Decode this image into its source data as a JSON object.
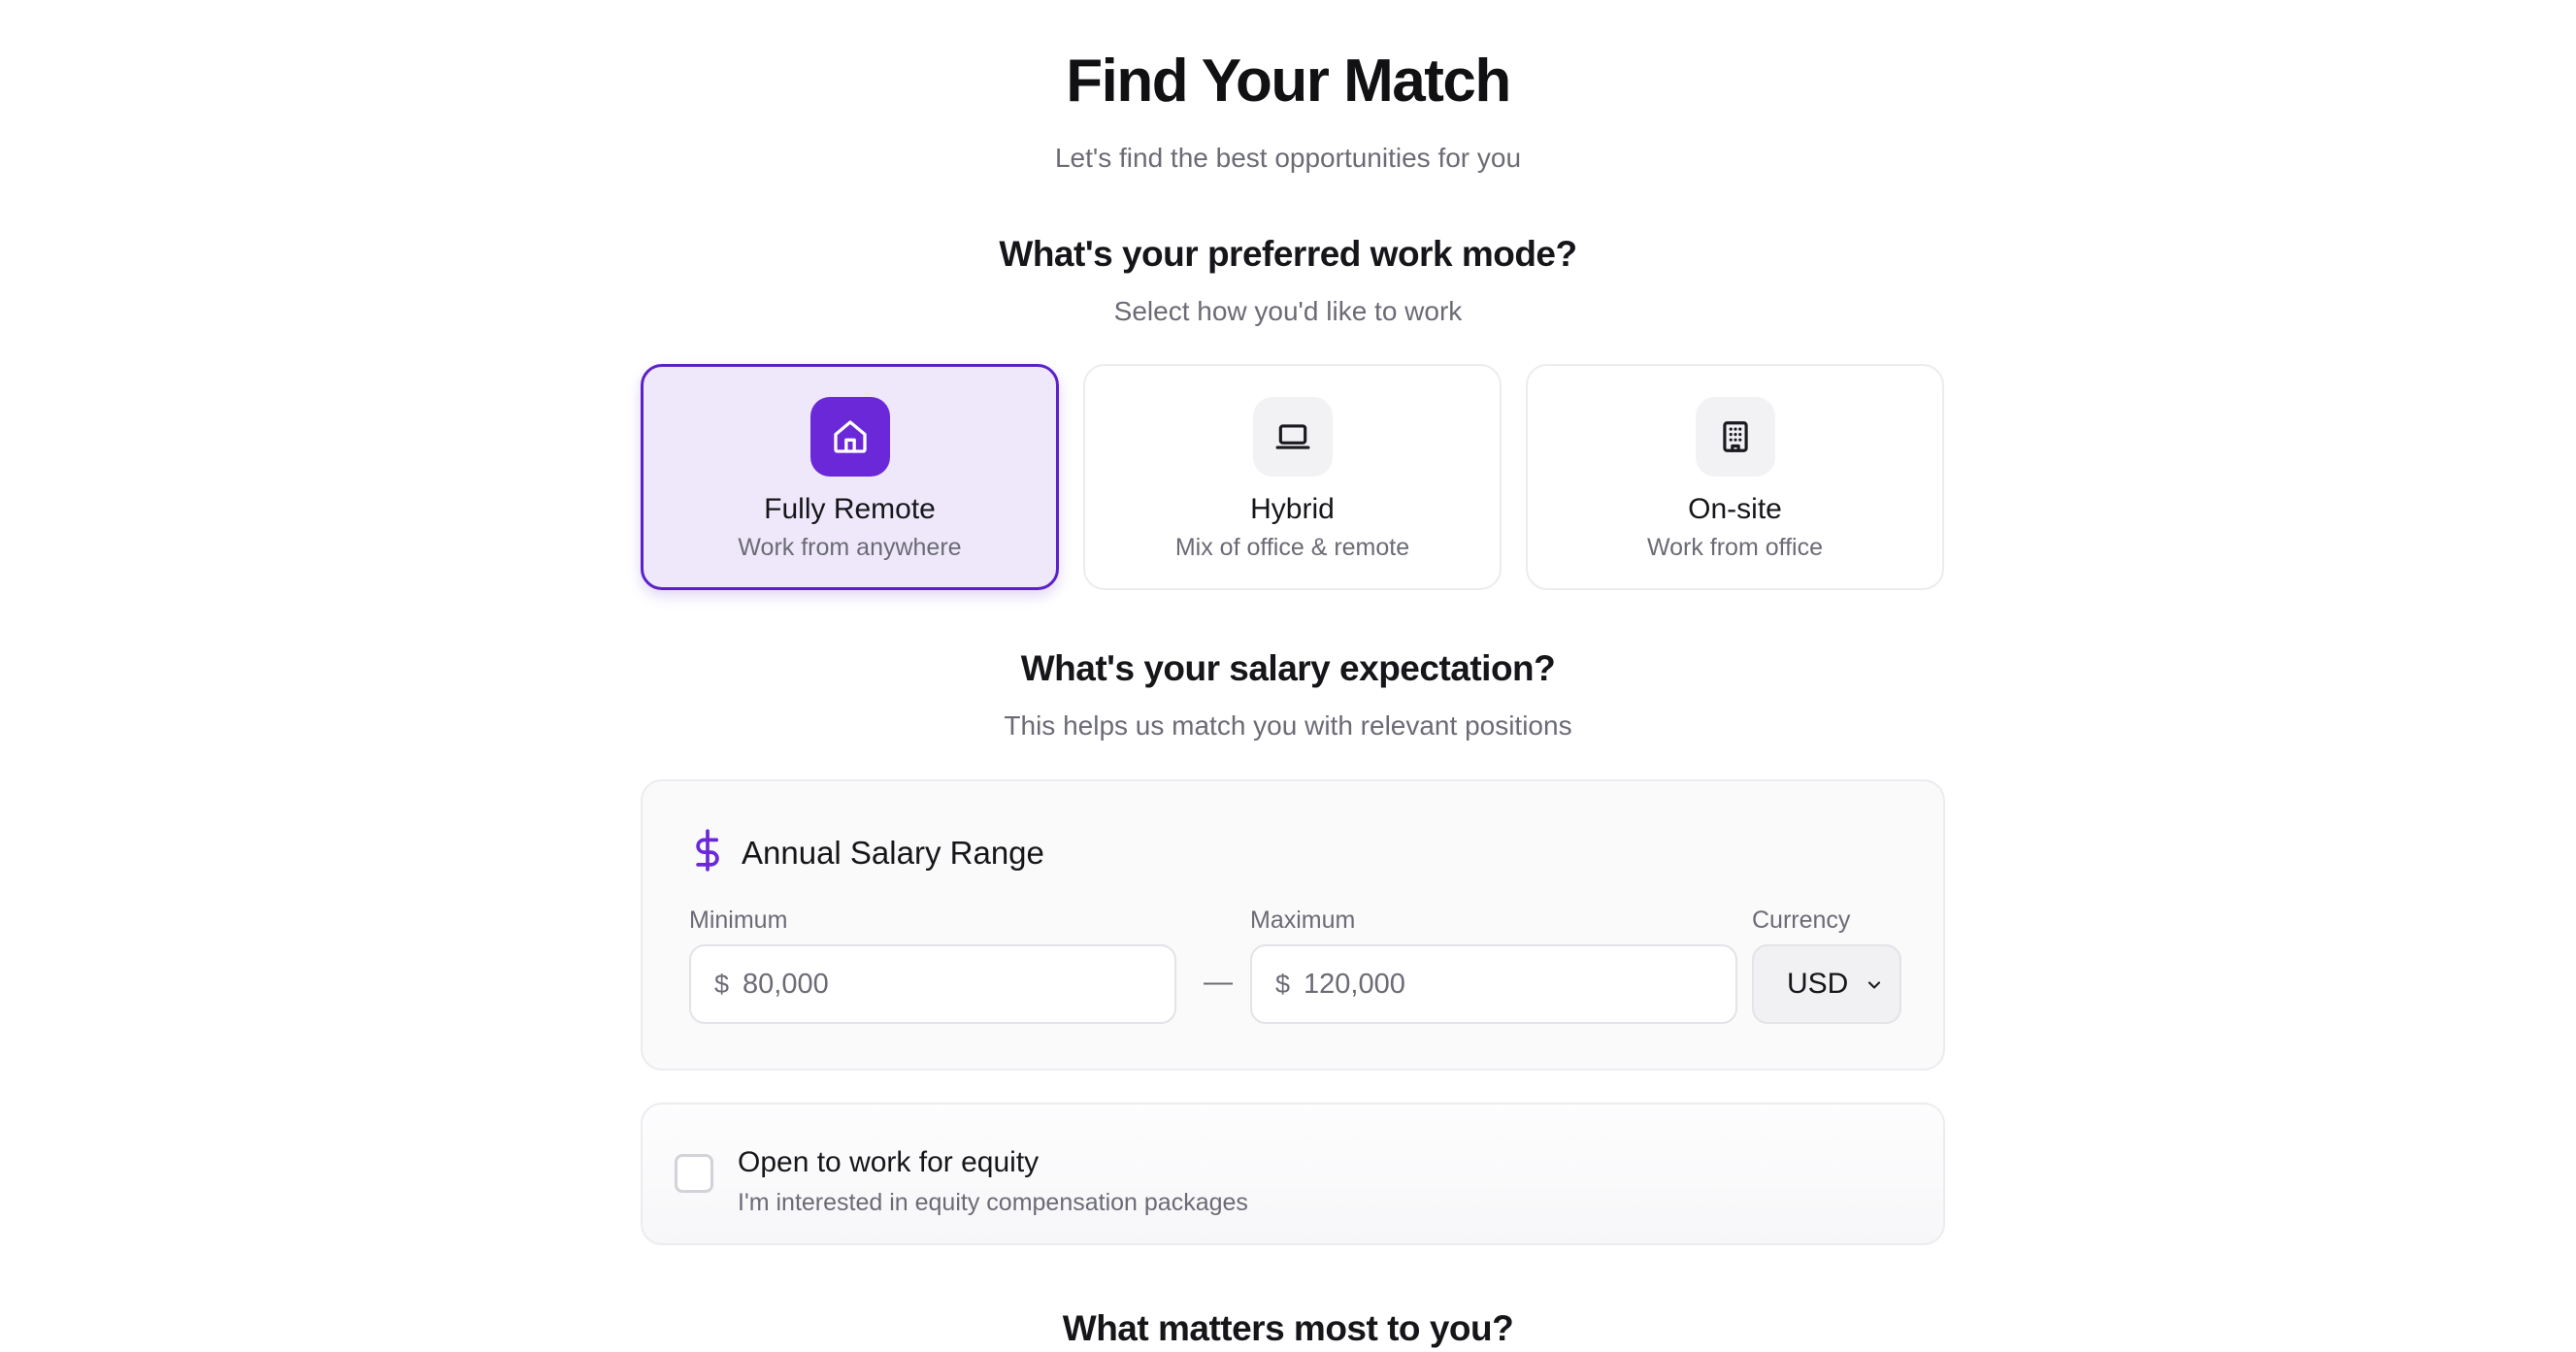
{
  "header": {
    "title": "Find Your Match",
    "subtitle": "Let's find the best opportunities for you"
  },
  "work_mode": {
    "question": "What's your preferred work mode?",
    "hint": "Select how you'd like to work",
    "options": [
      {
        "title": "Fully Remote",
        "description": "Work from anywhere",
        "icon": "home-icon",
        "selected": true
      },
      {
        "title": "Hybrid",
        "description": "Mix of office & remote",
        "icon": "laptop-icon",
        "selected": false
      },
      {
        "title": "On-site",
        "description": "Work from office",
        "icon": "building-icon",
        "selected": false
      }
    ]
  },
  "salary": {
    "question": "What's your salary expectation?",
    "hint": "This helps us match you with relevant positions",
    "panel_title": "Annual Salary Range",
    "panel_icon": "dollar-icon",
    "minimum": {
      "label": "Minimum",
      "prefix": "$",
      "value": "80,000"
    },
    "separator": "—",
    "maximum": {
      "label": "Maximum",
      "prefix": "$",
      "value": "120,000"
    },
    "currency": {
      "label": "Currency",
      "value": "USD"
    }
  },
  "equity": {
    "checked": false,
    "title": "Open to work for equity",
    "description": "I'm interested in equity compensation packages"
  },
  "priorities": {
    "question": "What matters most to you?"
  },
  "colors": {
    "accent": "#6a28d9",
    "accent_border": "#5b21c9",
    "selected_bg": "#efe8fa",
    "muted_text": "#6b6b76"
  }
}
